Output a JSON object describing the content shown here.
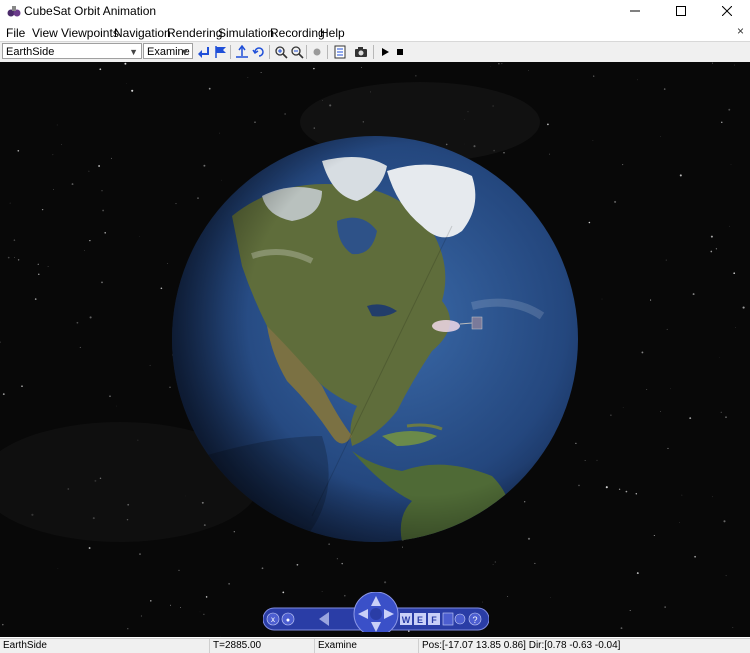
{
  "window": {
    "title": "CubeSat Orbit Animation",
    "app_icon": "vrml-viewer-icon"
  },
  "menubar": {
    "items": [
      "File",
      "View",
      "Viewpoints",
      "Navigation",
      "Rendering",
      "Simulation",
      "Recording",
      "Help"
    ],
    "close_glyph": "×"
  },
  "toolbar": {
    "viewpoint_value": "EarthSide",
    "navigation_mode_value": "Examine",
    "icons": [
      "go-to-viewpoint-icon",
      "flag-icon",
      "straighten-up-icon",
      "undo-move-icon",
      "zoom-in-icon",
      "zoom-out-icon",
      "record-icon",
      "notes-icon",
      "camera-icon",
      "play-icon",
      "stop-icon"
    ]
  },
  "navpanel": {
    "buttons": [
      "x",
      "●",
      "W",
      "E",
      "F",
      "?"
    ]
  },
  "statusbar": {
    "viewpoint": "EarthSide",
    "time": "T=2885.00",
    "mode": "Examine",
    "position": "Pos:[-17.07 13.85 0.86] Dir:[0.78 -0.63 -0.04]"
  },
  "colors": {
    "space": "#080808",
    "ocean": "#2a4f86",
    "land": "#5b6a3a",
    "ice": "#e6eaee",
    "nav_panel": "#2c3fa8"
  }
}
